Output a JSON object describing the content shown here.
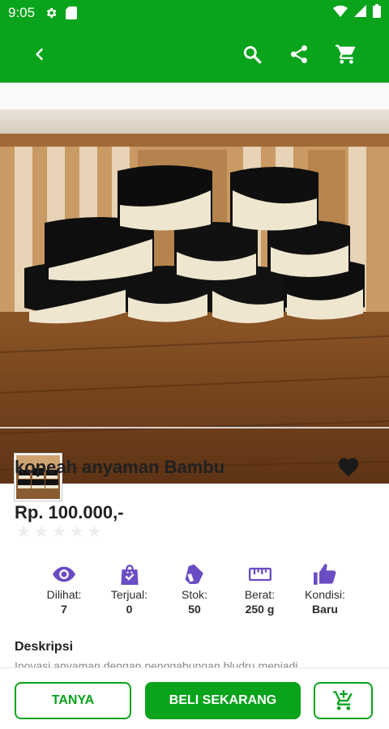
{
  "status_bar": {
    "time": "9:05",
    "icons": [
      "gear-icon",
      "sim-card-icon",
      "wifi-icon",
      "signal-icon",
      "battery-icon"
    ]
  },
  "app_bar": {
    "icons": [
      "back-icon",
      "search-icon",
      "share-icon",
      "cart-icon"
    ]
  },
  "colors": {
    "brand": "#0aa31c",
    "accent_purple": "#6a4cc3"
  },
  "product": {
    "title": "kopeah anyaman Bambu",
    "price": "Rp. 100.000,-",
    "rating": 0,
    "stats": [
      {
        "icon": "eye-icon",
        "label": "Dilihat:",
        "value": "7"
      },
      {
        "icon": "shopping-bag-icon",
        "label": "Terjual:",
        "value": "0"
      },
      {
        "icon": "stock-tag-icon",
        "label": "Stok:",
        "value": "50"
      },
      {
        "icon": "ruler-icon",
        "label": "Berat:",
        "value": "250 g"
      },
      {
        "icon": "thumbs-up-icon",
        "label": "Kondisi:",
        "value": "Baru"
      }
    ],
    "description_heading": "Deskripsi",
    "description_text": "Inovasi anyaman dengan penggabungan bludru menjadi"
  },
  "actions": {
    "ask_label": "TANYA",
    "buy_label": "BELI SEKARANG"
  }
}
